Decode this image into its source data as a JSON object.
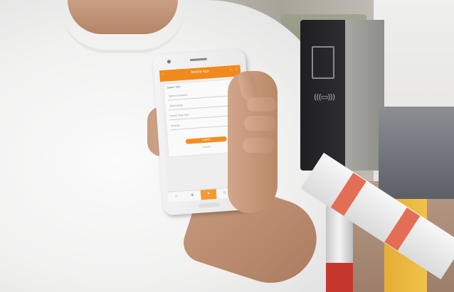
{
  "photo": {
    "subject": "",
    "phone_app": {
      "title": "Mobile App",
      "card_title": "Select Info",
      "fields": [
        {
          "label": "Select Company"
        },
        {
          "label": "Select Gate"
        },
        {
          "label": "Select Time Slot"
        },
        {
          "label": "Visit No."
        }
      ],
      "primary_button": "SUBMIT",
      "secondary_link": "CANCEL",
      "tabs": [
        "⌂",
        "▣",
        "⚑",
        "☺",
        "✎"
      ],
      "active_tab_index": 2,
      "accent_color": "#f18a1e"
    },
    "terminal_symbol": "((📶))"
  }
}
